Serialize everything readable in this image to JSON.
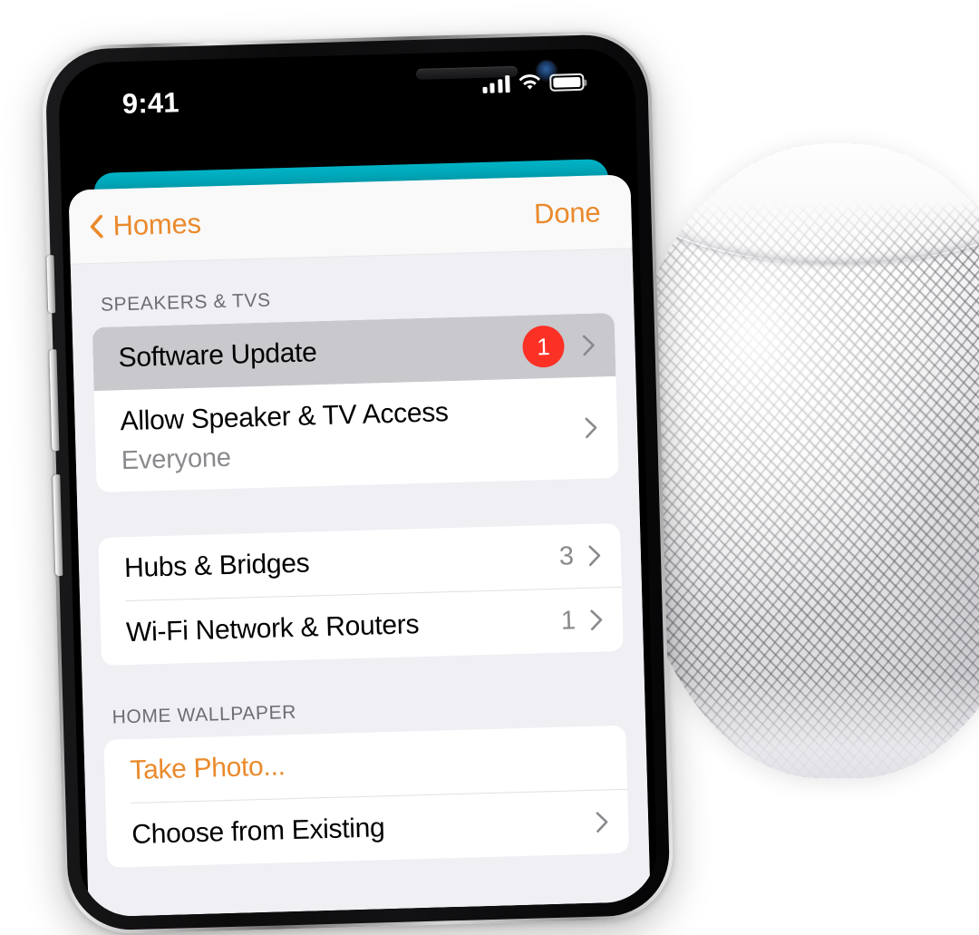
{
  "status_bar": {
    "time": "9:41",
    "cellular_icon": "signal-bars-icon",
    "wifi_icon": "wifi-icon",
    "battery_icon": "battery-icon"
  },
  "navbar": {
    "back_label": "Homes",
    "back_icon": "chevron-left-icon",
    "done_label": "Done"
  },
  "sections": [
    {
      "header": "SPEAKERS & TVS",
      "rows": [
        {
          "title": "Software Update",
          "badge": "1",
          "selected": true,
          "disclosure": "chevron-right-icon"
        },
        {
          "title": "Allow Speaker & TV Access",
          "subtitle": "Everyone",
          "disclosure": "chevron-right-icon"
        }
      ]
    },
    {
      "header": "",
      "rows": [
        {
          "title": "Hubs & Bridges",
          "value": "3",
          "disclosure": "chevron-right-icon"
        },
        {
          "title": "Wi-Fi Network & Routers",
          "value": "1",
          "disclosure": "chevron-right-icon"
        }
      ]
    },
    {
      "header": "HOME WALLPAPER",
      "rows": [
        {
          "title": "Take Photo...",
          "accent": true
        },
        {
          "title": "Choose from Existing",
          "disclosure": "chevron-right-icon"
        }
      ]
    }
  ],
  "device": {
    "homepod_label": "homepod-mini-speaker"
  },
  "colors": {
    "accent_orange": "#ea8a2c",
    "badge_red": "#fc3126",
    "teal_card": "#00a2b4",
    "selected_row": "#c8c8cd",
    "list_background": "#efeff4",
    "secondary_text": "#8a8a8e"
  }
}
